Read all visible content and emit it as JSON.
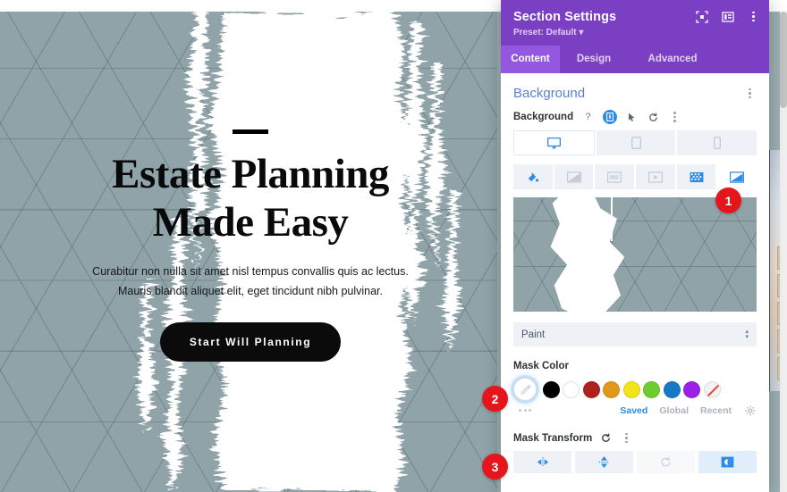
{
  "preview": {
    "hero": {
      "title": "Estate Planning Made Easy",
      "subtitle": "Curabitur non nulla sit amet nisl tempus convallis quis ac lectus. Mauris blandit aliquet elit, eget tincidunt nibh pulvinar.",
      "button_label": "Start Will Planning"
    },
    "background_color": "#8fa3a8",
    "mask_color": "#ffffff"
  },
  "panel": {
    "title": "Section Settings",
    "preset": "Preset: Default",
    "header_icons": [
      {
        "name": "focus-icon"
      },
      {
        "name": "layout-panel-icon"
      },
      {
        "name": "more-options-icon"
      }
    ],
    "tabs": [
      {
        "label": "Content",
        "active": true
      },
      {
        "label": "Design",
        "active": false
      },
      {
        "label": "Advanced",
        "active": false
      }
    ],
    "accent_purple": "#7b3fc4",
    "accent_purple_active": "#9457e0",
    "accent_blue": "#2d8ce8"
  },
  "background_section": {
    "heading": "Background",
    "field_label": "Background",
    "field_icons": [
      "help-icon",
      "responsive-icon",
      "hover-icon",
      "reset-icon",
      "more-icon"
    ],
    "device_tabs": [
      {
        "name": "desktop",
        "active": true
      },
      {
        "name": "tablet",
        "active": false
      },
      {
        "name": "phone",
        "active": false
      }
    ],
    "type_tabs": [
      {
        "name": "background-color",
        "active": false
      },
      {
        "name": "background-gradient",
        "active": false
      },
      {
        "name": "background-image",
        "active": false
      },
      {
        "name": "background-video",
        "active": false
      },
      {
        "name": "background-pattern",
        "active": false
      },
      {
        "name": "background-mask",
        "active": true
      }
    ],
    "mask_select_value": "Paint"
  },
  "mask_color": {
    "label": "Mask Color",
    "swatches": [
      {
        "name": "black",
        "hex": "#000000"
      },
      {
        "name": "white",
        "hex": "#ffffff"
      },
      {
        "name": "red",
        "hex": "#b0201c"
      },
      {
        "name": "orange",
        "hex": "#e0981a"
      },
      {
        "name": "yellow",
        "hex": "#f2e41b"
      },
      {
        "name": "green",
        "hex": "#6dcd2e"
      },
      {
        "name": "blue",
        "hex": "#1878c8"
      },
      {
        "name": "purple",
        "hex": "#9b1fe8"
      },
      {
        "name": "none",
        "hex": "transparent"
      }
    ],
    "source_tabs": [
      {
        "label": "Saved",
        "active": true
      },
      {
        "label": "Global",
        "active": false
      },
      {
        "label": "Recent",
        "active": false
      }
    ]
  },
  "mask_transform": {
    "label": "Mask Transform",
    "buttons": [
      {
        "name": "flip-horizontal",
        "state": "enabled"
      },
      {
        "name": "flip-vertical",
        "state": "enabled"
      },
      {
        "name": "rotate",
        "state": "disabled"
      },
      {
        "name": "invert",
        "state": "active"
      }
    ]
  },
  "annotations": [
    {
      "number": "1"
    },
    {
      "number": "2"
    },
    {
      "number": "3"
    }
  ]
}
